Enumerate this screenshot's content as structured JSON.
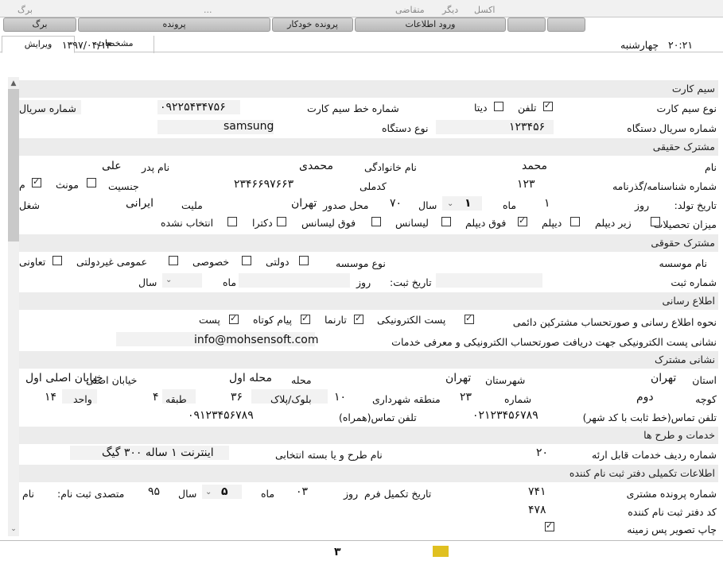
{
  "menu": {
    "back": "برگ",
    "dots": "...",
    "applicant": "متقاضی",
    "other": "دیگر",
    "excel": "اکسل"
  },
  "toolbar": {
    "back": "برگ",
    "file": "پرونده",
    "auto_file": "پرونده خودکار",
    "data_entry": "ورود اطلاعات"
  },
  "tabs": {
    "edit": "ویرایش",
    "details": "مشخصات"
  },
  "header": {
    "date": "۱۳۹۷/۰۴/۱۳",
    "weekday": "چهارشنبه",
    "time": "۲۰:۲۱"
  },
  "sim": {
    "section": "سیم کارت",
    "card_type_label": "نوع سیم کارت",
    "phone": "تلفن",
    "data": "دیتا",
    "line_number_label": "شماره خط سیم کارت",
    "line_number": "۰۹۲۲۵۴۳۴۷۵۶",
    "serial_label": "شماره سریال",
    "device_serial_label": "شماره سریال دستگاه",
    "device_serial": "۱۲۳۴۵۶",
    "device_type_label": "نوع دستگاه",
    "device_type": "samsung"
  },
  "real": {
    "section": "مشترک حقیقی",
    "name_label": "نام",
    "name": "محمد",
    "family_label": "نام خانوادگی",
    "family": "محمدی",
    "father_label": "نام پدر",
    "father": "علی",
    "id_label": "شماره شناسنامه/گذرنامه",
    "id": "۱۲۳",
    "national_label": "کدملی",
    "national": "۲۳۴۶۶۹۷۶۶۳",
    "gender_label": "جنسیت",
    "female": "مونث",
    "m": "م",
    "birth_label": "تاریخ تولد:",
    "day_label": "روز",
    "day": "۱",
    "month_label": "ماه",
    "month": "۱",
    "year_label": "سال",
    "year": "۷۰",
    "issue_label": "محل صدور",
    "issue": "تهران",
    "nationality_label": "ملیت",
    "nationality": "ایرانی",
    "job_label": "شغل",
    "edu_label": "میزان تحصیلات",
    "edu": [
      "زیر دیپلم",
      "دیپلم",
      "فوق دیپلم",
      "لیسانس",
      "فوق لیسانس",
      "دکترا",
      "انتخاب نشده"
    ]
  },
  "legal": {
    "section": "مشترک حقوقی",
    "inst_name_label": "نام موسسه",
    "inst_type_label": "نوع موسسه",
    "types": [
      "دولتی",
      "خصوصی",
      "عمومی غیردولتی",
      "تعاونی"
    ],
    "reg_label": "شماره ثبت",
    "reg_date_label": "تاریخ ثبت:",
    "day_label": "روز",
    "month_label": "ماه",
    "year_label": "سال"
  },
  "notify": {
    "section": "اطلاع رسانی",
    "method_label": "نحوه اطلاع رسانی و صورتحساب مشترکین دائمی",
    "methods": [
      "پست الکترونیکی",
      "تارنما",
      "پیام کوتاه",
      "پست"
    ],
    "email_label": "نشانی پست الکترونیکی جهت دریافت صورتحساب الکترونیکی و معرفی خدمات",
    "email": "info@mohsensoft.com"
  },
  "address": {
    "section": "نشانی مشترک",
    "province_label": "استان",
    "province": "تهران",
    "city_label": "شهرستان",
    "city": "تهران",
    "district_label": "محله",
    "district": "محله اول",
    "street_label": "خیابان اصلی",
    "street": "خیابان اصلی اول",
    "alley_label": "کوچه",
    "alley": "دوم",
    "number_label": "شماره",
    "number": "۲۳",
    "zone_label": "منطقه شهرداری",
    "zone": "۱۰",
    "plaque_label": "بلوک/پلاک",
    "plaque": "۳۶",
    "floor_label": "طبقه",
    "floor": "۴",
    "unit_label": "واحد",
    "unit": "۱۴",
    "tel_label": "تلفن تماس(خط ثابت با کد شهر)",
    "tel": "۰۲۱۲۳۴۵۶۷۸۹",
    "mobile_label": "تلفن تماس(همراه)",
    "mobile": "۰۹۱۲۳۴۵۶۷۸۹"
  },
  "services": {
    "section": "خدمات و طرح ها",
    "row_label": "شماره ردیف خدمات قابل ارئه",
    "row": "۲۰",
    "plan_label": "نام طرح و یا بسته انتخابی",
    "plan": "اینترنت ۱ ساله ۳۰۰ گیگ"
  },
  "extra": {
    "section": "اطلاعات تکمیلی دفتر ثبت نام کننده",
    "file_label": "شماره پرونده مشتری",
    "file": "۷۴۱",
    "form_date_label": "تاریخ تکمیل فرم",
    "day_label": "روز",
    "day": "۰۳",
    "month_label": "ماه",
    "month": "۵",
    "year_label": "سال",
    "year": "۹۵",
    "operator_label": "متصدی ثبت نام:",
    "name_label": "نام",
    "office_code_label": "کد دفتر ثبت نام کننده",
    "office_code": "۴۷۸",
    "print_bg_label": "چاپ تصویر پس زمینه"
  },
  "footer": {
    "status": "۳"
  }
}
